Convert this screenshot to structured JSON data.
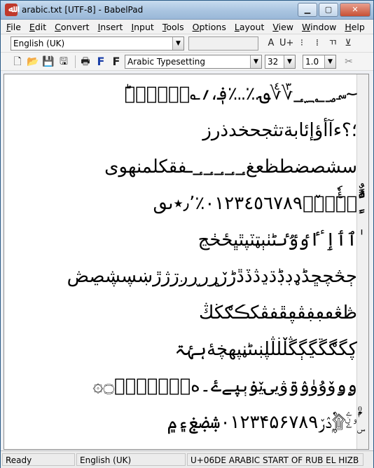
{
  "window": {
    "title": "arabic.txt [UTF-8] - BabelPad",
    "minimize": "▁",
    "maximize": "▢",
    "close": "✕"
  },
  "menu": [
    {
      "label": "File",
      "key": "F",
      "rest": "ile"
    },
    {
      "label": "Edit",
      "key": "E",
      "rest": "dit"
    },
    {
      "label": "Convert",
      "key": "C",
      "rest": "onvert"
    },
    {
      "label": "Insert",
      "key": "I",
      "rest": "nsert"
    },
    {
      "label": "Input",
      "key": "I",
      "rest": "nput"
    },
    {
      "label": "Tools",
      "key": "T",
      "rest": "ools"
    },
    {
      "label": "Options",
      "key": "O",
      "rest": "ptions"
    },
    {
      "label": "Layout",
      "key": "L",
      "rest": "ayout"
    },
    {
      "label": "View",
      "key": "V",
      "rest": "iew"
    },
    {
      "label": "Window",
      "key": "W",
      "rest": "indow"
    },
    {
      "label": "Help",
      "key": "H",
      "rest": "elp"
    }
  ],
  "toolbar1": {
    "language": "English (UK)",
    "right_icons": [
      "A",
      "U+",
      "⁝",
      "⁞",
      "ㄲ",
      "⊻"
    ]
  },
  "toolbar2": {
    "font": "Arabic Typesetting",
    "size": "32",
    "spacing": "1.0",
    "icons": [
      "new-file-icon",
      "open-folder-icon",
      "save-icon",
      "save-all-icon",
      "print-icon",
      "font-blue-icon",
      "font-black-icon",
      "cut-icon"
    ],
    "font_blue_label": "F",
    "font_black_label": "F",
    "cut_label": "✂"
  },
  "editor_lines": [
    "؀؁؂؃؄؅؆؇؈؉؊؋،؍؎؏ؐؑؒؓؔؕ",
    "؛؟ءآأؤإئابةتثجحخدذرز",
    "سشصضطظعغ؀؀؀؀؀ـفقكلمنهوى",
    "ًٌٍَُِّْٕٖٜٓٔٗ٘ٙٚٛ٠١٢٣٤٥٦٧٨٩٪٫٬٭ٮٯ",
    "ٰٱٲٳٴٵٶٷٸٹٺٻټٽپٿڀځڂڃ",
    "ڄڅچڇڈډڊڋڌڍڎڏڐڑڒړڔڕږڗژڙښڛڜڝڞ",
    "ڟڠڡڢڣڤڥڦڧڨکڪګڬڭ",
    "ڮگڰڱڲڳڴڵڶڷڸڹںڻڼڽھڿۀہۂۃ",
    "ۄۅۆۇۈۉۊۋیۍێۏېۑےۓ۔ەۖۗۘۙۚۛۜ۝۞",
    "ۣ۟۠ۡۢۤۥۦۧۨ۩۪ۭ۫۬ۮۯ۰۱۲۳۴۵۶۷۸۹ۺۻۼ۽۾"
  ],
  "status": {
    "state": "Ready",
    "language": "English (UK)",
    "char_info": "U+06DE ARABIC START OF RUB EL HIZB"
  }
}
